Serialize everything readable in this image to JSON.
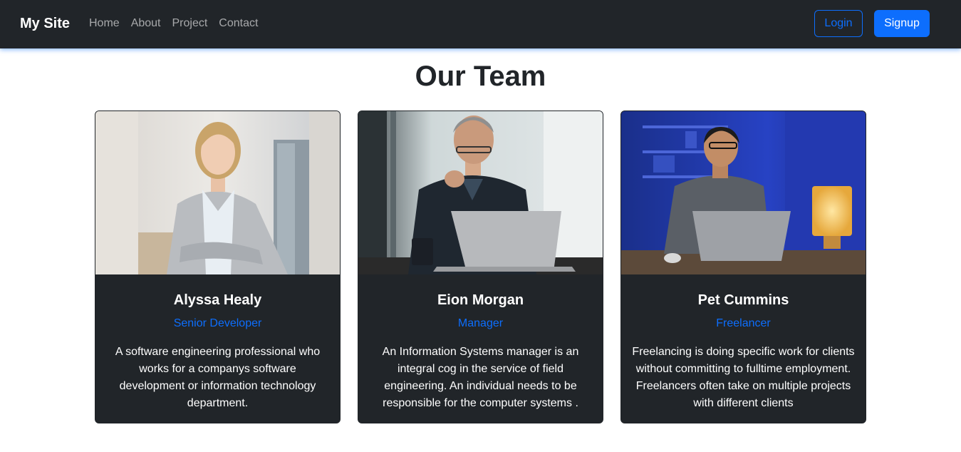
{
  "navbar": {
    "brand": "My Site",
    "links": [
      "Home",
      "About",
      "Project",
      "Contact"
    ],
    "login_label": "Login",
    "signup_label": "Signup"
  },
  "main": {
    "title": "Our Team",
    "cards": [
      {
        "name": "Alyssa Healy",
        "role": "Senior Developer",
        "description": "A software engineering professional who works for a companys software development or information technology department."
      },
      {
        "name": "Eion Morgan",
        "role": "Manager",
        "description": "An Information Systems manager is an integral cog in the service of field engineering. An individual needs to be responsible for the computer systems ."
      },
      {
        "name": "Pet Cummins",
        "role": "Freelancer",
        "description": "Freelancing is doing specific work for clients without committing to fulltime employment. Freelancers often take on multiple projects with different clients"
      }
    ]
  },
  "colors": {
    "navbar_bg": "#212529",
    "accent": "#0d6efd",
    "card_bg": "#212529"
  }
}
